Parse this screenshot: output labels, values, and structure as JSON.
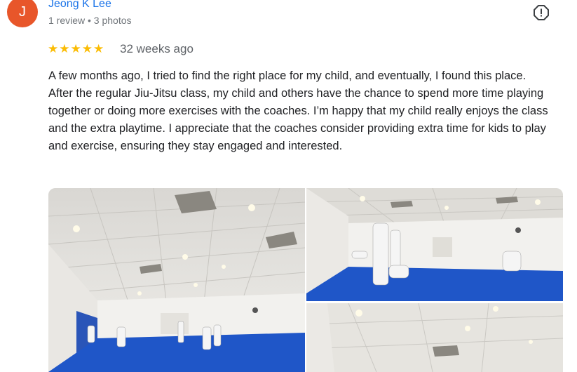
{
  "review": {
    "avatar_letter": "J",
    "author_name": "Jeong K Lee",
    "author_meta": "1 review • 3 photos",
    "rating": 5,
    "stars": "★★★★★",
    "time": "32 weeks ago",
    "paragraphs": [
      "A few months ago, I tried to find the right place for my child, and eventually, I found this place.",
      "After the regular Jiu-Jitsu class, my child and others have the chance to spend more time playing together or doing more exercises with the coaches. I’m happy that my child really enjoys the class and the extra playtime. I appreciate that the coaches consider providing extra time for kids to play and exercise, ensuring they stay engaged and interested."
    ]
  },
  "icons": {
    "report": "report-flag-icon"
  },
  "colors": {
    "avatar_bg": "#e8562a",
    "author_link": "#1a73e8",
    "star": "#fbbc04",
    "mat_blue": "#1f56c8"
  }
}
